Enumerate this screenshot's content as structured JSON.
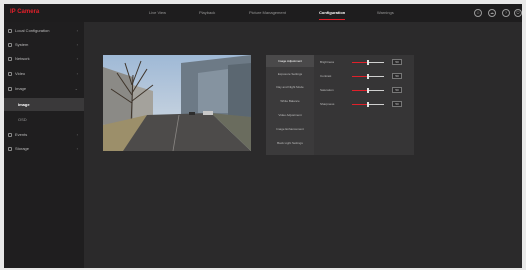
{
  "header": {
    "brand": "IP Camera",
    "nav": [
      "Live View",
      "Playback",
      "Picture Management",
      "Configuration",
      "Warnings"
    ],
    "active_nav": "Configuration",
    "icons": [
      "user-icon",
      "cloud-icon",
      "help-icon",
      "power-icon"
    ]
  },
  "sidebar": {
    "items": [
      {
        "label": "Local Configuration",
        "icon": "monitor-icon"
      },
      {
        "label": "System",
        "icon": "system-icon"
      },
      {
        "label": "Network",
        "icon": "network-icon"
      },
      {
        "label": "Video",
        "icon": "video-icon"
      },
      {
        "label": "Image",
        "icon": "image-icon"
      }
    ],
    "subitems": [
      {
        "label": "Image",
        "active": true
      },
      {
        "label": "OSD",
        "active": false
      }
    ],
    "items_after": [
      {
        "label": "Events",
        "icon": "events-icon"
      },
      {
        "label": "Storage",
        "icon": "storage-icon"
      }
    ]
  },
  "settings": {
    "tabs": [
      "Image Adjustment",
      "Exposure Settings",
      "Day and Night Mode",
      "White Balance",
      "Video Adjustment",
      "Image Enhancement",
      "Back Light Settings"
    ],
    "active_tab": "Image Adjustment",
    "sliders": [
      {
        "label": "Brightness",
        "value": "50",
        "fraction": 0.5
      },
      {
        "label": "Contrast",
        "value": "50",
        "fraction": 0.5
      },
      {
        "label": "Saturation",
        "value": "50",
        "fraction": 0.5
      },
      {
        "label": "Sharpness",
        "value": "50",
        "fraction": 0.5
      }
    ]
  },
  "colors": {
    "accent": "#e0202a",
    "background": "#2b2a2b",
    "topbar": "#1e1d1e",
    "sidebar": "#1f1e1f"
  }
}
